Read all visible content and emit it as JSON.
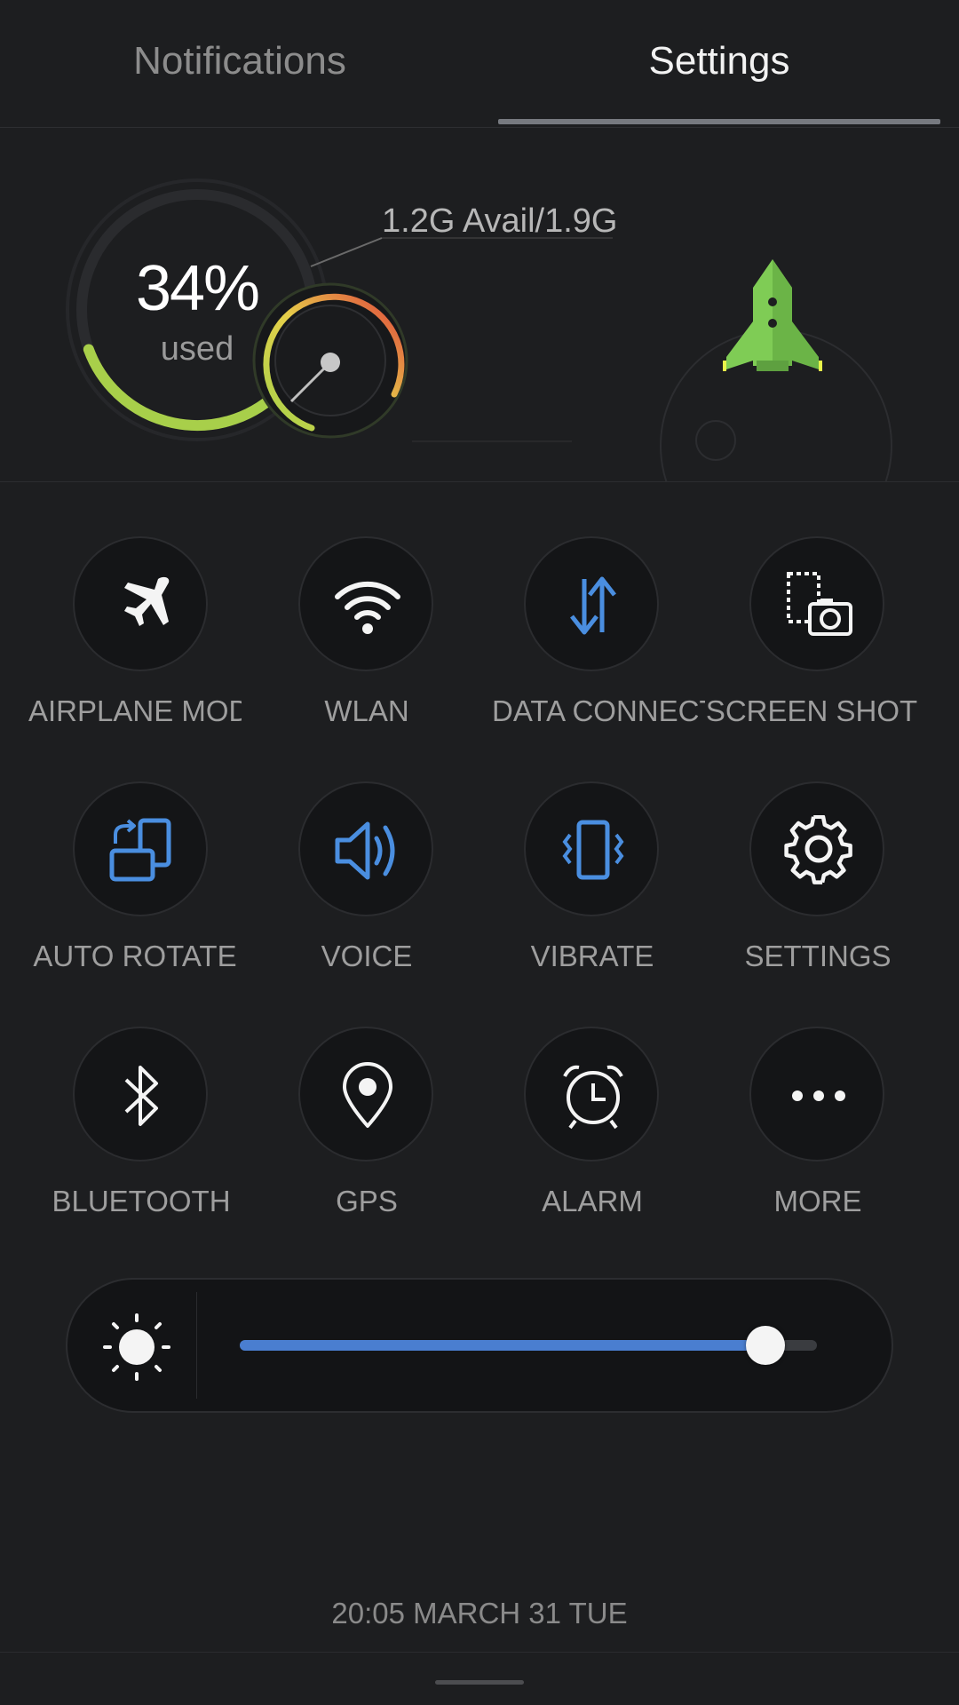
{
  "tabs": [
    {
      "label": "Notifications",
      "active": false
    },
    {
      "label": "Settings",
      "active": true
    }
  ],
  "memory": {
    "percent_text": "34%",
    "used_label": "used",
    "avail_text": "1.2G Avail/1.9G",
    "used_fraction": 0.34
  },
  "toggles": [
    {
      "label": "AIRPLANE MODE",
      "icon": "airplane-icon",
      "active": false
    },
    {
      "label": "WLAN",
      "icon": "wifi-icon",
      "active": false
    },
    {
      "label": "DATA CONNECTION",
      "icon": "data-connection-icon",
      "active": true
    },
    {
      "label": "SCREEN SHOT",
      "icon": "screenshot-icon",
      "active": false
    },
    {
      "label": "AUTO ROTATE",
      "icon": "auto-rotate-icon",
      "active": true
    },
    {
      "label": "VOICE",
      "icon": "speaker-icon",
      "active": true
    },
    {
      "label": "VIBRATE",
      "icon": "vibrate-icon",
      "active": true
    },
    {
      "label": "SETTINGS",
      "icon": "gear-icon",
      "active": false
    },
    {
      "label": "BLUETOOTH",
      "icon": "bluetooth-icon",
      "active": false
    },
    {
      "label": "GPS",
      "icon": "location-pin-icon",
      "active": false
    },
    {
      "label": "ALARM",
      "icon": "alarm-clock-icon",
      "active": false
    },
    {
      "label": "MORE",
      "icon": "more-icon",
      "active": false
    }
  ],
  "brightness": {
    "icon": "sun-icon",
    "level": 0.91
  },
  "datetime": "20:05 MARCH 31 TUE",
  "colors": {
    "accent": "#4a7ed0",
    "rocket": "#7fcc55",
    "gauge_low": "#a6d24a",
    "gauge_high": "#e0443c"
  }
}
